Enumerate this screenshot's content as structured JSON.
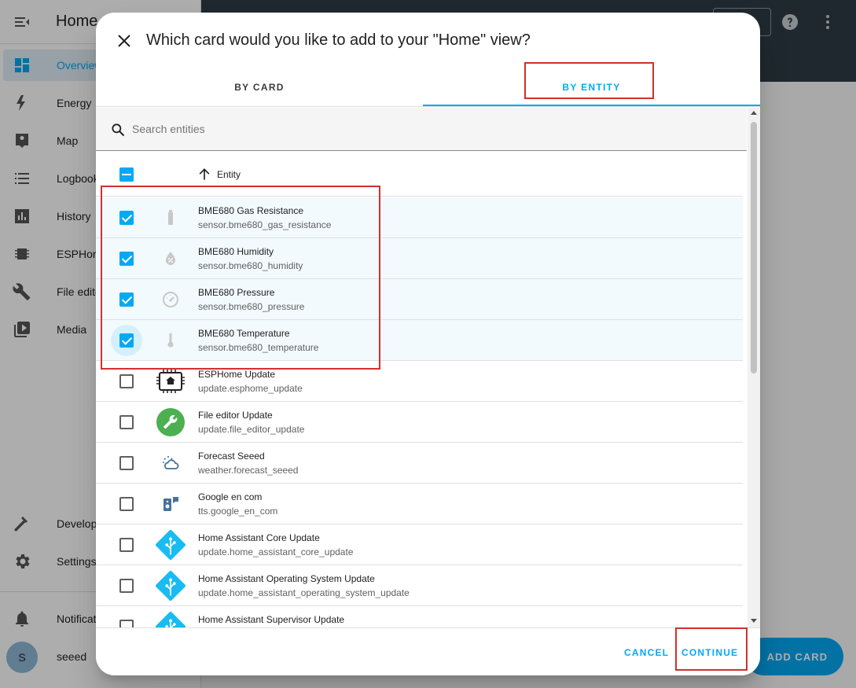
{
  "app": {
    "title": "Home",
    "nav": [
      {
        "label": "Overview",
        "icon": "dashboard-icon",
        "active": true
      },
      {
        "label": "Energy",
        "icon": "lightning-icon"
      },
      {
        "label": "Map",
        "icon": "map-person-icon"
      },
      {
        "label": "Logbook",
        "icon": "list-icon"
      },
      {
        "label": "History",
        "icon": "chart-icon"
      },
      {
        "label": "ESPHome",
        "icon": "chip-icon"
      },
      {
        "label": "File editor",
        "icon": "wrench-icon"
      },
      {
        "label": "Media",
        "icon": "media-icon"
      }
    ],
    "bottom_nav": [
      {
        "label": "Developer tools",
        "icon": "hammer-icon"
      },
      {
        "label": "Settings",
        "icon": "gear-icon"
      }
    ],
    "notifications_label": "Notifications",
    "user": {
      "initial": "S",
      "name": "seeed"
    },
    "fab_label": "ADD CARD",
    "accent": "#03a9f4",
    "header_color": "#2f3c45"
  },
  "dialog": {
    "title": "Which card would you like to add to your \"Home\" view?",
    "tabs": [
      {
        "label": "BY CARD",
        "active": false
      },
      {
        "label": "BY ENTITY",
        "active": true
      }
    ],
    "search": {
      "placeholder": "Search entities",
      "value": ""
    },
    "column_header": "Entity",
    "entities": [
      {
        "name": "BME680 Gas Resistance",
        "id": "sensor.bme680_gas_resistance",
        "checked": true,
        "icon": "gas-cylinder-icon"
      },
      {
        "name": "BME680 Humidity",
        "id": "sensor.bme680_humidity",
        "checked": true,
        "icon": "water-percent-icon"
      },
      {
        "name": "BME680 Pressure",
        "id": "sensor.bme680_pressure",
        "checked": true,
        "icon": "gauge-icon"
      },
      {
        "name": "BME680 Temperature",
        "id": "sensor.bme680_temperature",
        "checked": true,
        "icon": "thermometer-icon"
      },
      {
        "name": "ESPHome Update",
        "id": "update.esphome_update",
        "checked": false,
        "icon": "esphome-icon"
      },
      {
        "name": "File editor Update",
        "id": "update.file_editor_update",
        "checked": false,
        "icon": "file-editor-icon"
      },
      {
        "name": "Forecast Seeed",
        "id": "weather.forecast_seeed",
        "checked": false,
        "icon": "weather-partly-cloudy-icon"
      },
      {
        "name": "Google en com",
        "id": "tts.google_en_com",
        "checked": false,
        "icon": "speaker-message-icon"
      },
      {
        "name": "Home Assistant Core Update",
        "id": "update.home_assistant_core_update",
        "checked": false,
        "icon": "home-assistant-icon"
      },
      {
        "name": "Home Assistant Operating System Update",
        "id": "update.home_assistant_operating_system_update",
        "checked": false,
        "icon": "home-assistant-icon"
      },
      {
        "name": "Home Assistant Supervisor Update",
        "id": "",
        "checked": false,
        "icon": "home-assistant-icon"
      }
    ],
    "cancel_label": "CANCEL",
    "continue_label": "CONTINUE"
  }
}
